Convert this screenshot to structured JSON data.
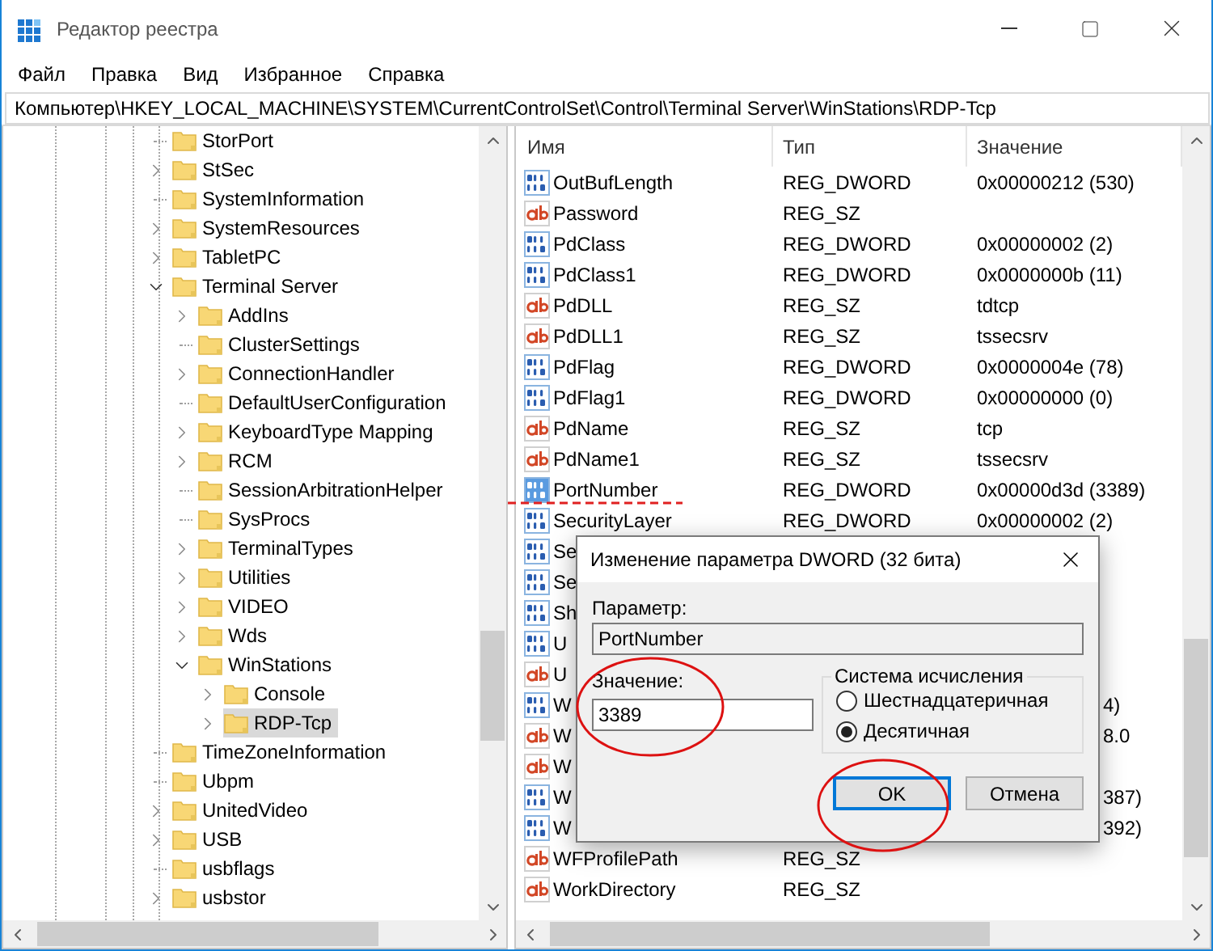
{
  "window": {
    "title": "Редактор реестра"
  },
  "menu": [
    {
      "label": "Файл"
    },
    {
      "label": "Правка"
    },
    {
      "label": "Вид"
    },
    {
      "label": "Избранное"
    },
    {
      "label": "Справка"
    }
  ],
  "address": "Компьютер\\HKEY_LOCAL_MACHINE\\SYSTEM\\CurrentControlSet\\Control\\Terminal Server\\WinStations\\RDP-Tcp",
  "tree": [
    {
      "label": "StorPort",
      "expandable": false,
      "selected": false
    },
    {
      "label": "StSec",
      "expandable": true,
      "expanded": false,
      "selected": false
    },
    {
      "label": "SystemInformation",
      "expandable": false,
      "selected": false
    },
    {
      "label": "SystemResources",
      "expandable": true,
      "expanded": false,
      "selected": false
    },
    {
      "label": "TabletPC",
      "expandable": true,
      "expanded": false,
      "selected": false
    },
    {
      "label": "Terminal Server",
      "expandable": true,
      "expanded": true,
      "selected": false,
      "children": [
        {
          "label": "AddIns",
          "expandable": true,
          "expanded": false,
          "selected": false
        },
        {
          "label": "ClusterSettings",
          "expandable": false,
          "selected": false
        },
        {
          "label": "ConnectionHandler",
          "expandable": true,
          "expanded": false,
          "selected": false
        },
        {
          "label": "DefaultUserConfiguration",
          "expandable": false,
          "selected": false
        },
        {
          "label": "KeyboardType Mapping",
          "expandable": true,
          "expanded": false,
          "selected": false
        },
        {
          "label": "RCM",
          "expandable": true,
          "expanded": false,
          "selected": false
        },
        {
          "label": "SessionArbitrationHelper",
          "expandable": false,
          "selected": false
        },
        {
          "label": "SysProcs",
          "expandable": false,
          "selected": false
        },
        {
          "label": "TerminalTypes",
          "expandable": true,
          "expanded": false,
          "selected": false
        },
        {
          "label": "Utilities",
          "expandable": true,
          "expanded": false,
          "selected": false
        },
        {
          "label": "VIDEO",
          "expandable": true,
          "expanded": false,
          "selected": false
        },
        {
          "label": "Wds",
          "expandable": true,
          "expanded": false,
          "selected": false
        },
        {
          "label": "WinStations",
          "expandable": true,
          "expanded": true,
          "selected": false,
          "children": [
            {
              "label": "Console",
              "expandable": true,
              "expanded": false,
              "selected": false
            },
            {
              "label": "RDP-Tcp",
              "expandable": true,
              "expanded": false,
              "selected": true
            }
          ]
        }
      ]
    },
    {
      "label": "TimeZoneInformation",
      "expandable": false,
      "selected": false
    },
    {
      "label": "Ubpm",
      "expandable": false,
      "selected": false
    },
    {
      "label": "UnitedVideo",
      "expandable": true,
      "expanded": false,
      "selected": false
    },
    {
      "label": "USB",
      "expandable": true,
      "expanded": false,
      "selected": false
    },
    {
      "label": "usbflags",
      "expandable": false,
      "selected": false
    },
    {
      "label": "usbstor",
      "expandable": true,
      "expanded": false,
      "selected": false
    }
  ],
  "list": {
    "columns": [
      "Имя",
      "Тип",
      "Значение"
    ],
    "rows": [
      {
        "kind": "dword",
        "name": "OutBufLength",
        "type": "REG_DWORD",
        "value": "0x00000212 (530)",
        "selected": false
      },
      {
        "kind": "sz",
        "name": "Password",
        "type": "REG_SZ",
        "selected": false
      },
      {
        "kind": "dword",
        "name": "PdClass",
        "type": "REG_DWORD",
        "value": "0x00000002 (2)",
        "selected": false
      },
      {
        "kind": "dword",
        "name": "PdClass1",
        "type": "REG_DWORD",
        "value": "0x0000000b (11)",
        "selected": false
      },
      {
        "kind": "sz",
        "name": "PdDLL",
        "type": "REG_SZ",
        "value": "tdtcp",
        "selected": false
      },
      {
        "kind": "sz",
        "name": "PdDLL1",
        "type": "REG_SZ",
        "value": "tssecsrv",
        "selected": false
      },
      {
        "kind": "dword",
        "name": "PdFlag",
        "type": "REG_DWORD",
        "value": "0x0000004e (78)",
        "selected": false
      },
      {
        "kind": "dword",
        "name": "PdFlag1",
        "type": "REG_DWORD",
        "value": "0x00000000 (0)",
        "selected": false
      },
      {
        "kind": "sz",
        "name": "PdName",
        "type": "REG_SZ",
        "value": "tcp",
        "selected": false
      },
      {
        "kind": "sz",
        "name": "PdName1",
        "type": "REG_SZ",
        "value": "tssecsrv",
        "selected": false
      },
      {
        "kind": "dword",
        "name": "PortNumber",
        "type": "REG_DWORD",
        "value": "0x00000d3d (3389)",
        "selected": true
      },
      {
        "kind": "dword",
        "name": "SecurityLayer",
        "type": "REG_DWORD",
        "value": "0x00000002 (2)",
        "selected": false
      },
      {
        "kind": "dword",
        "name": "Se",
        "selected": false
      },
      {
        "kind": "dword",
        "name": "Se",
        "selected": false
      },
      {
        "kind": "dword",
        "name": "Sh",
        "selected": false
      },
      {
        "kind": "dword",
        "name": "U",
        "selected": false
      },
      {
        "kind": "sz",
        "name": "U",
        "selected": false
      },
      {
        "kind": "dword",
        "name": "W",
        "value_tail": "4)",
        "selected": false
      },
      {
        "kind": "sz",
        "name": "W",
        "value_tail": "8.0",
        "selected": false
      },
      {
        "kind": "sz",
        "name": "W",
        "selected": false
      },
      {
        "kind": "dword",
        "name": "W",
        "value_tail": "387)",
        "selected": false
      },
      {
        "kind": "dword",
        "name": "W",
        "value_tail": "392)",
        "selected": false
      },
      {
        "kind": "sz",
        "name": "WFProfilePath",
        "type": "REG_SZ",
        "selected": false
      },
      {
        "kind": "sz",
        "name": "WorkDirectory",
        "type": "REG_SZ",
        "selected": false
      }
    ]
  },
  "dialog": {
    "title": "Изменение параметра DWORD (32 бита)",
    "name_label": "Параметр:",
    "name_value": "PortNumber",
    "value_label": "Значение:",
    "value": "3389",
    "base_group": {
      "title": "Система исчисления",
      "options": [
        {
          "label": "Шестнадцатеричная",
          "selected": false
        },
        {
          "label": "Десятичная",
          "selected": true
        }
      ]
    },
    "buttons": [
      {
        "label": "OK",
        "default": true
      },
      {
        "label": "Отмена",
        "default": false
      }
    ]
  }
}
